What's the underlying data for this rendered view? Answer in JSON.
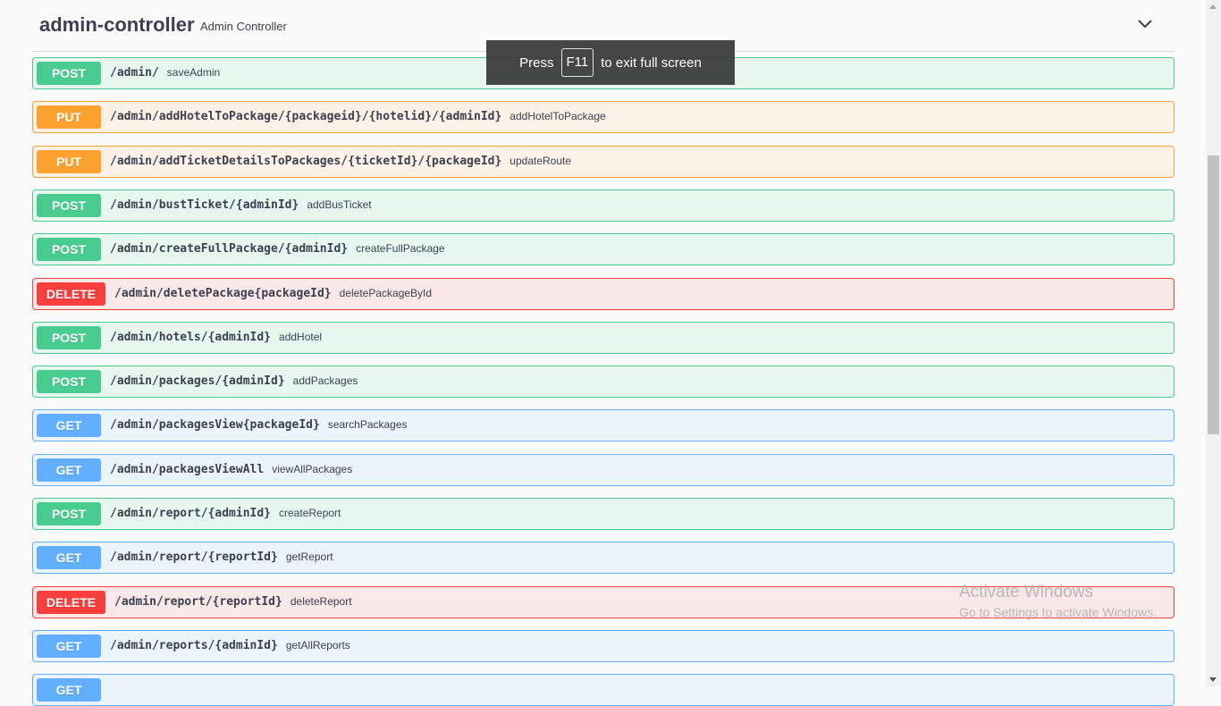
{
  "tag": {
    "name": "admin-controller",
    "description": "Admin Controller",
    "toggle_icon": "chevron-down-icon"
  },
  "operations": [
    {
      "method": "POST",
      "path": "/admin/",
      "summary": "saveAdmin"
    },
    {
      "method": "PUT",
      "path": "/admin/addHotelToPackage/{packageid}/{hotelid}/{adminId}",
      "summary": "addHotelToPackage"
    },
    {
      "method": "PUT",
      "path": "/admin/addTicketDetailsToPackages/{ticketId}/{packageId}",
      "summary": "updateRoute"
    },
    {
      "method": "POST",
      "path": "/admin/bustTicket/{adminId}",
      "summary": "addBusTicket"
    },
    {
      "method": "POST",
      "path": "/admin/createFullPackage/{adminId}",
      "summary": "createFullPackage"
    },
    {
      "method": "DELETE",
      "path": "/admin/deletePackage{packageId}",
      "summary": "deletePackageById"
    },
    {
      "method": "POST",
      "path": "/admin/hotels/{adminId}",
      "summary": "addHotel"
    },
    {
      "method": "POST",
      "path": "/admin/packages/{adminId}",
      "summary": "addPackages"
    },
    {
      "method": "GET",
      "path": "/admin/packagesView{packageId}",
      "summary": "searchPackages"
    },
    {
      "method": "GET",
      "path": "/admin/packagesViewAll",
      "summary": "viewAllPackages"
    },
    {
      "method": "POST",
      "path": "/admin/report/{adminId}",
      "summary": "createReport"
    },
    {
      "method": "GET",
      "path": "/admin/report/{reportId}",
      "summary": "getReport"
    },
    {
      "method": "DELETE",
      "path": "/admin/report/{reportId}",
      "summary": "deleteReport"
    },
    {
      "method": "GET",
      "path": "/admin/reports/{adminId}",
      "summary": "getAllReports"
    },
    {
      "method": "GET",
      "path": "",
      "summary": ""
    }
  ],
  "fullscreen_toast": {
    "before": "Press",
    "key": "F11",
    "after": "to exit full screen"
  },
  "watermark": {
    "title": "Activate Windows",
    "subtitle": "Go to Settings to activate Windows."
  },
  "colors": {
    "post": "#49cc90",
    "put": "#fca130",
    "delete": "#f93e3e",
    "get": "#61affe",
    "text": "#3b4151"
  }
}
